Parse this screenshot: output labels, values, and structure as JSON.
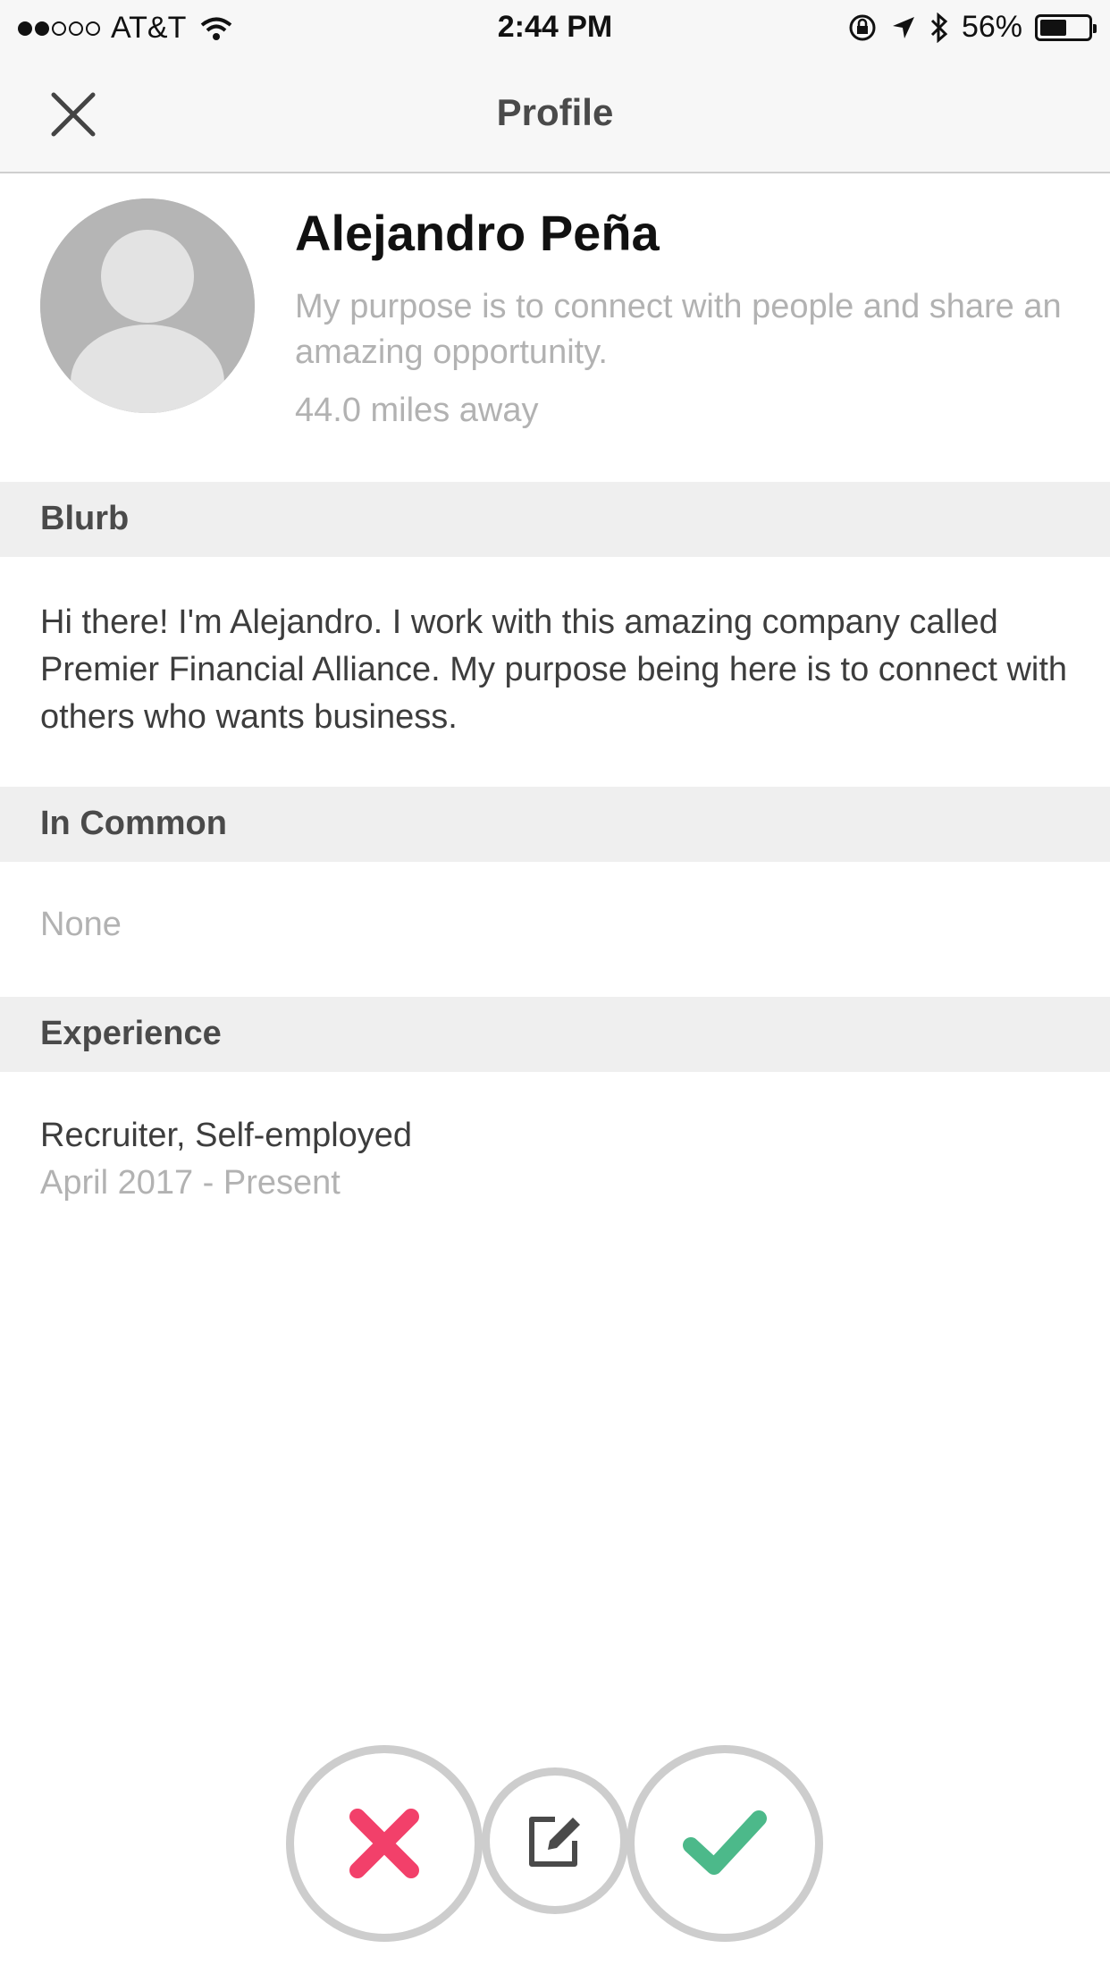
{
  "status_bar": {
    "carrier": "AT&T",
    "time": "2:44 PM",
    "battery_percent": "56%",
    "battery_level": 0.56
  },
  "nav": {
    "title": "Profile",
    "close_icon": "close-icon"
  },
  "profile": {
    "name": "Alejandro Peña",
    "purpose": "My purpose is to connect with people and share an amazing opportunity.",
    "distance": "44.0 miles away"
  },
  "sections": {
    "blurb": {
      "title": "Blurb",
      "text": "Hi there! I'm Alejandro. I work with this amazing company called Premier Financial Alliance. My purpose being here is to connect with others who wants business."
    },
    "in_common": {
      "title": "In Common",
      "text": "None"
    },
    "experience": {
      "title": "Experience",
      "role": "Recruiter, Self-employed",
      "dates": "April 2017 - Present"
    }
  },
  "actions": {
    "reject_color": "#f2406a",
    "accept_color": "#4cb98a",
    "edit_color": "#4a4a4a"
  }
}
